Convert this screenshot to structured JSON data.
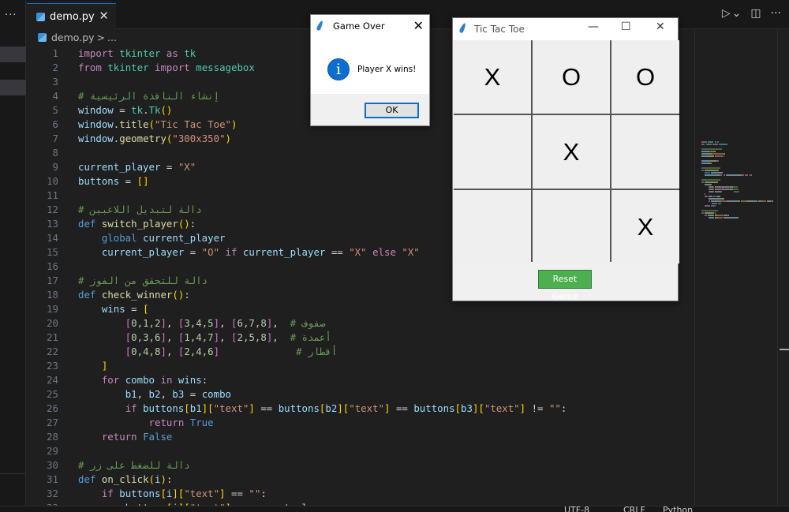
{
  "editor": {
    "tab_label": "demo.py",
    "tab_close": "✕",
    "breadcrumb_file": "demo.py",
    "breadcrumb_sep": ">",
    "breadcrumb_more": "...",
    "toolbar": {
      "run": "▷",
      "run_menu": "⌄",
      "split": "◫",
      "more": "···"
    },
    "activity_more": "···",
    "start_line": 1,
    "lines": [
      [
        [
          "import",
          "k"
        ],
        [
          " ",
          "o"
        ],
        [
          "tkinter",
          "m"
        ],
        [
          " ",
          "o"
        ],
        [
          "as",
          "k"
        ],
        [
          " ",
          "o"
        ],
        [
          "tk",
          "m"
        ]
      ],
      [
        [
          "from",
          "k"
        ],
        [
          " ",
          "o"
        ],
        [
          "tkinter",
          "m"
        ],
        [
          " ",
          "o"
        ],
        [
          "import",
          "k"
        ],
        [
          " ",
          "o"
        ],
        [
          "messagebox",
          "m"
        ]
      ],
      [],
      [
        [
          "# إنشاء النافذة الرئيسية",
          "c"
        ]
      ],
      [
        [
          "window",
          "v"
        ],
        [
          " = ",
          "o"
        ],
        [
          "tk",
          "m"
        ],
        [
          ".",
          "o"
        ],
        [
          "Tk",
          "m"
        ],
        [
          "()",
          "p1"
        ]
      ],
      [
        [
          "window",
          "v"
        ],
        [
          ".",
          "o"
        ],
        [
          "title",
          "f"
        ],
        [
          "(",
          "p1"
        ],
        [
          "\"Tic Tac Toe\"",
          "s"
        ],
        [
          ")",
          "p1"
        ]
      ],
      [
        [
          "window",
          "v"
        ],
        [
          ".",
          "o"
        ],
        [
          "geometry",
          "f"
        ],
        [
          "(",
          "p1"
        ],
        [
          "\"300x350\"",
          "s"
        ],
        [
          ")",
          "p1"
        ]
      ],
      [],
      [
        [
          "current_player",
          "v"
        ],
        [
          " = ",
          "o"
        ],
        [
          "\"X\"",
          "s"
        ]
      ],
      [
        [
          "buttons",
          "v"
        ],
        [
          " = ",
          "o"
        ],
        [
          "[]",
          "p1"
        ]
      ],
      [],
      [
        [
          "# دالة لتبديل اللاعبين",
          "c"
        ]
      ],
      [
        [
          "def",
          "b"
        ],
        [
          " ",
          "o"
        ],
        [
          "switch_player",
          "f"
        ],
        [
          "()",
          "p1"
        ],
        [
          ":",
          "o"
        ]
      ],
      [
        [
          "    ",
          "o"
        ],
        [
          "global",
          "b"
        ],
        [
          " ",
          "o"
        ],
        [
          "current_player",
          "v"
        ]
      ],
      [
        [
          "    ",
          "o"
        ],
        [
          "current_player",
          "v"
        ],
        [
          " = ",
          "o"
        ],
        [
          "\"O\"",
          "s"
        ],
        [
          " ",
          "o"
        ],
        [
          "if",
          "k"
        ],
        [
          " ",
          "o"
        ],
        [
          "current_player",
          "v"
        ],
        [
          " == ",
          "o"
        ],
        [
          "\"X\"",
          "s"
        ],
        [
          " ",
          "o"
        ],
        [
          "else",
          "k"
        ],
        [
          " ",
          "o"
        ],
        [
          "\"X\"",
          "s"
        ]
      ],
      [],
      [
        [
          "# دالة للتحقق من الفوز",
          "c"
        ]
      ],
      [
        [
          "def",
          "b"
        ],
        [
          " ",
          "o"
        ],
        [
          "check_winner",
          "f"
        ],
        [
          "()",
          "p1"
        ],
        [
          ":",
          "o"
        ]
      ],
      [
        [
          "    ",
          "o"
        ],
        [
          "wins",
          "v"
        ],
        [
          " = ",
          "o"
        ],
        [
          "[",
          "p1"
        ]
      ],
      [
        [
          "        ",
          "o"
        ],
        [
          "[",
          "p2"
        ],
        [
          "0,1,2",
          "n"
        ],
        [
          "]",
          "p2"
        ],
        [
          ", ",
          "o"
        ],
        [
          "[",
          "p2"
        ],
        [
          "3,4,5",
          "n"
        ],
        [
          "]",
          "p2"
        ],
        [
          ", ",
          "o"
        ],
        [
          "[",
          "p2"
        ],
        [
          "6,7,8",
          "n"
        ],
        [
          "]",
          "p2"
        ],
        [
          ",  ",
          "o"
        ],
        [
          "# صفوف",
          "c"
        ]
      ],
      [
        [
          "        ",
          "o"
        ],
        [
          "[",
          "p2"
        ],
        [
          "0,3,6",
          "n"
        ],
        [
          "]",
          "p2"
        ],
        [
          ", ",
          "o"
        ],
        [
          "[",
          "p2"
        ],
        [
          "1,4,7",
          "n"
        ],
        [
          "]",
          "p2"
        ],
        [
          ", ",
          "o"
        ],
        [
          "[",
          "p2"
        ],
        [
          "2,5,8",
          "n"
        ],
        [
          "]",
          "p2"
        ],
        [
          ",  ",
          "o"
        ],
        [
          "# أعمدة",
          "c"
        ]
      ],
      [
        [
          "        ",
          "o"
        ],
        [
          "[",
          "p2"
        ],
        [
          "0,4,8",
          "n"
        ],
        [
          "]",
          "p2"
        ],
        [
          ", ",
          "o"
        ],
        [
          "[",
          "p2"
        ],
        [
          "2,4,6",
          "n"
        ],
        [
          "]",
          "p2"
        ],
        [
          "             ",
          "o"
        ],
        [
          "# أقطار",
          "c"
        ]
      ],
      [
        [
          "    ",
          "o"
        ],
        [
          "]",
          "p1"
        ]
      ],
      [
        [
          "    ",
          "o"
        ],
        [
          "for",
          "k"
        ],
        [
          " ",
          "o"
        ],
        [
          "combo",
          "v"
        ],
        [
          " ",
          "o"
        ],
        [
          "in",
          "k"
        ],
        [
          " ",
          "o"
        ],
        [
          "wins",
          "v"
        ],
        [
          ":",
          "o"
        ]
      ],
      [
        [
          "        ",
          "o"
        ],
        [
          "b1",
          "v"
        ],
        [
          ", ",
          "o"
        ],
        [
          "b2",
          "v"
        ],
        [
          ", ",
          "o"
        ],
        [
          "b3",
          "v"
        ],
        [
          " = ",
          "o"
        ],
        [
          "combo",
          "v"
        ]
      ],
      [
        [
          "        ",
          "o"
        ],
        [
          "if",
          "k"
        ],
        [
          " ",
          "o"
        ],
        [
          "buttons",
          "v"
        ],
        [
          "[",
          "p1"
        ],
        [
          "b1",
          "v"
        ],
        [
          "]",
          "p1"
        ],
        [
          "[",
          "p1"
        ],
        [
          "\"text\"",
          "s"
        ],
        [
          "]",
          "p1"
        ],
        [
          " == ",
          "o"
        ],
        [
          "buttons",
          "v"
        ],
        [
          "[",
          "p1"
        ],
        [
          "b2",
          "v"
        ],
        [
          "]",
          "p1"
        ],
        [
          "[",
          "p1"
        ],
        [
          "\"text\"",
          "s"
        ],
        [
          "]",
          "p1"
        ],
        [
          " == ",
          "o"
        ],
        [
          "buttons",
          "v"
        ],
        [
          "[",
          "p1"
        ],
        [
          "b3",
          "v"
        ],
        [
          "]",
          "p1"
        ],
        [
          "[",
          "p1"
        ],
        [
          "\"text\"",
          "s"
        ],
        [
          "]",
          "p1"
        ],
        [
          " != ",
          "o"
        ],
        [
          "\"\"",
          "s"
        ],
        [
          ":",
          "o"
        ]
      ],
      [
        [
          "            ",
          "o"
        ],
        [
          "return",
          "k"
        ],
        [
          " ",
          "o"
        ],
        [
          "True",
          "b"
        ]
      ],
      [
        [
          "    ",
          "o"
        ],
        [
          "return",
          "k"
        ],
        [
          " ",
          "o"
        ],
        [
          "False",
          "b"
        ]
      ],
      [],
      [
        [
          "# دالة للضغط على زر",
          "c"
        ]
      ],
      [
        [
          "def",
          "b"
        ],
        [
          " ",
          "o"
        ],
        [
          "on_click",
          "f"
        ],
        [
          "(",
          "p1"
        ],
        [
          "i",
          "v"
        ],
        [
          ")",
          "p1"
        ],
        [
          ":",
          "o"
        ]
      ],
      [
        [
          "    ",
          "o"
        ],
        [
          "if",
          "k"
        ],
        [
          " ",
          "o"
        ],
        [
          "buttons",
          "v"
        ],
        [
          "[",
          "p1"
        ],
        [
          "i",
          "v"
        ],
        [
          "]",
          "p1"
        ],
        [
          "[",
          "p1"
        ],
        [
          "\"text\"",
          "s"
        ],
        [
          "]",
          "p1"
        ],
        [
          " == ",
          "o"
        ],
        [
          "\"\"",
          "s"
        ],
        [
          ":",
          "o"
        ]
      ],
      [
        [
          "        ",
          "o"
        ],
        [
          "buttons",
          "v"
        ],
        [
          "[",
          "p1"
        ],
        [
          "i",
          "v"
        ],
        [
          "]",
          "p1"
        ],
        [
          "[",
          "p1"
        ],
        [
          "\"text\"",
          "s"
        ],
        [
          "]",
          "p1"
        ],
        [
          " = ",
          "o"
        ],
        [
          "current_player",
          "v"
        ]
      ]
    ]
  },
  "status_bar": {
    "encoding": "UTF-8",
    "eol": "CRLF",
    "language": "Python"
  },
  "dialog": {
    "title": "Game Over",
    "close": "✕",
    "icon": "info-icon",
    "icon_glyph": "i",
    "message": "Player X wins!",
    "ok_label": "OK"
  },
  "game": {
    "title": "Tic Tac Toe",
    "controls": {
      "minimize": "—",
      "maximize": "☐",
      "close": "✕"
    },
    "board": [
      "X",
      "O",
      "O",
      "",
      "X",
      "",
      "",
      "",
      "X"
    ],
    "reset_label": "Reset Game",
    "reset_color": "#4caf50"
  }
}
